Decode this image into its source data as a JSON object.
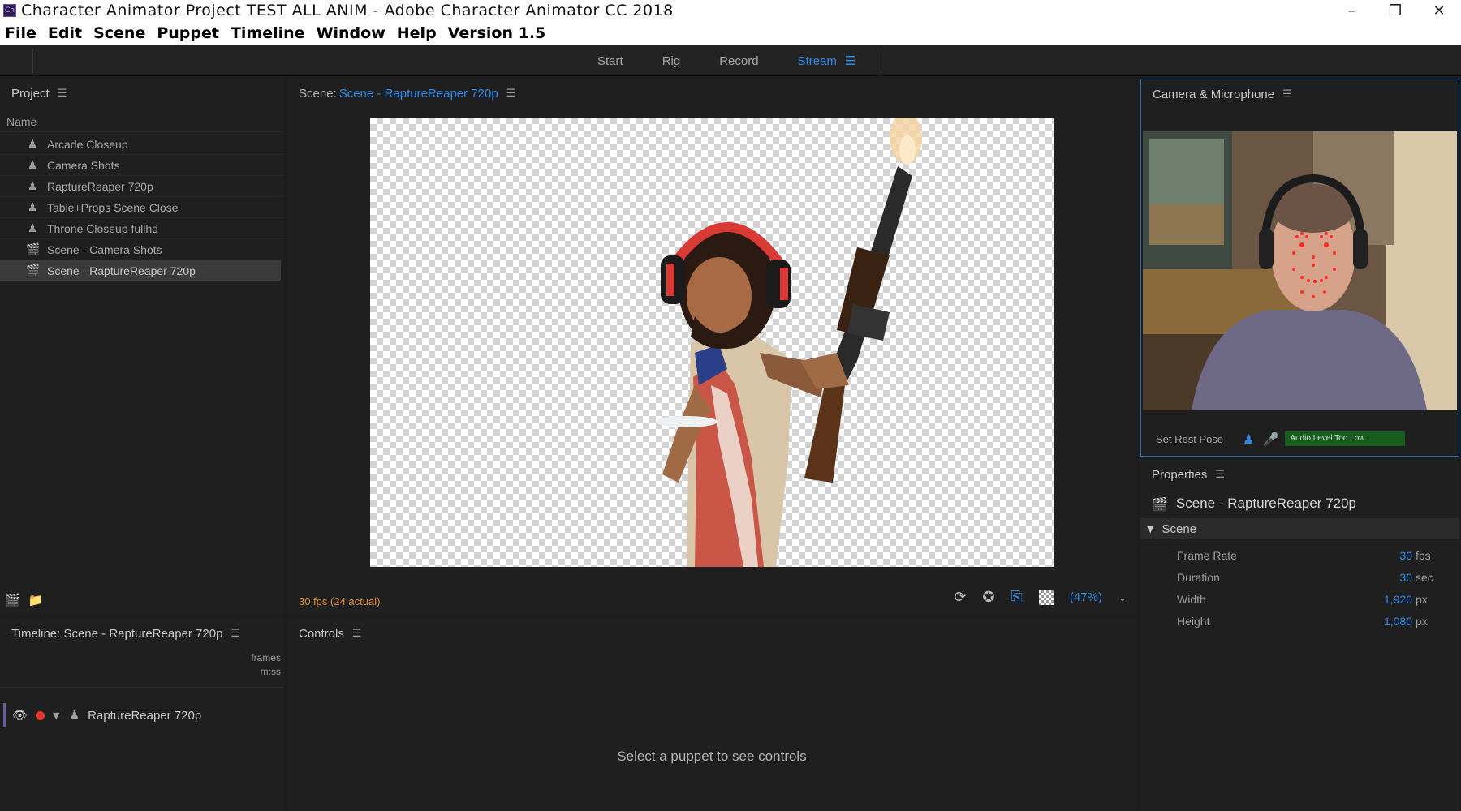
{
  "window": {
    "app_icon": "Ch",
    "title": "Character Animator Project  TEST ALL ANIM - Adobe Character Animator CC 2018",
    "controls": [
      "minimize-icon",
      "restore-icon",
      "close-icon"
    ]
  },
  "menu": [
    "File",
    "Edit",
    "Scene",
    "Puppet",
    "Timeline",
    "Window",
    "Help",
    "Version 1.5"
  ],
  "workspace": {
    "tabs": [
      "Start",
      "Rig",
      "Record",
      "Stream"
    ],
    "active": "Stream",
    "accent": "#2d8ceb"
  },
  "project": {
    "title": "Project",
    "column": "Name",
    "items": [
      {
        "label": "Arcade Closeup",
        "icon": "puppet-icon"
      },
      {
        "label": "Camera Shots",
        "icon": "puppet-icon"
      },
      {
        "label": "RaptureReaper 720p",
        "icon": "puppet-icon"
      },
      {
        "label": "Table+Props Scene Close",
        "icon": "puppet-icon"
      },
      {
        "label": "Throne Closeup fullhd",
        "icon": "puppet-icon"
      },
      {
        "label": "Scene - Camera Shots",
        "icon": "scene-icon"
      },
      {
        "label": "Scene - RaptureReaper 720p",
        "icon": "scene-icon",
        "selected": true
      }
    ]
  },
  "scene": {
    "prefix": "Scene:",
    "name": "Scene - RaptureReaper 720p",
    "fps": "30 fps (24 actual)",
    "zoom": "(47%)"
  },
  "camera": {
    "title": "Camera & Microphone",
    "set_rest_pose": "Set Rest Pose",
    "audio_status": "Audio Level Too Low"
  },
  "properties": {
    "title": "Properties",
    "object": "Scene - RaptureReaper 720p",
    "section": "Scene",
    "rows": [
      {
        "label": "Frame Rate",
        "value": "30",
        "unit": "fps"
      },
      {
        "label": "Duration",
        "value": "30",
        "unit": "sec"
      },
      {
        "label": "Width",
        "value": "1,920",
        "unit": "px"
      },
      {
        "label": "Height",
        "value": "1,080",
        "unit": "px"
      }
    ]
  },
  "timeline": {
    "title": "Timeline: Scene - RaptureReaper 720p",
    "scale_top": "frames",
    "scale_bottom": "m:ss",
    "track": "RaptureReaper 720p"
  },
  "controls": {
    "title": "Controls",
    "empty_message": "Select a puppet to see controls"
  }
}
